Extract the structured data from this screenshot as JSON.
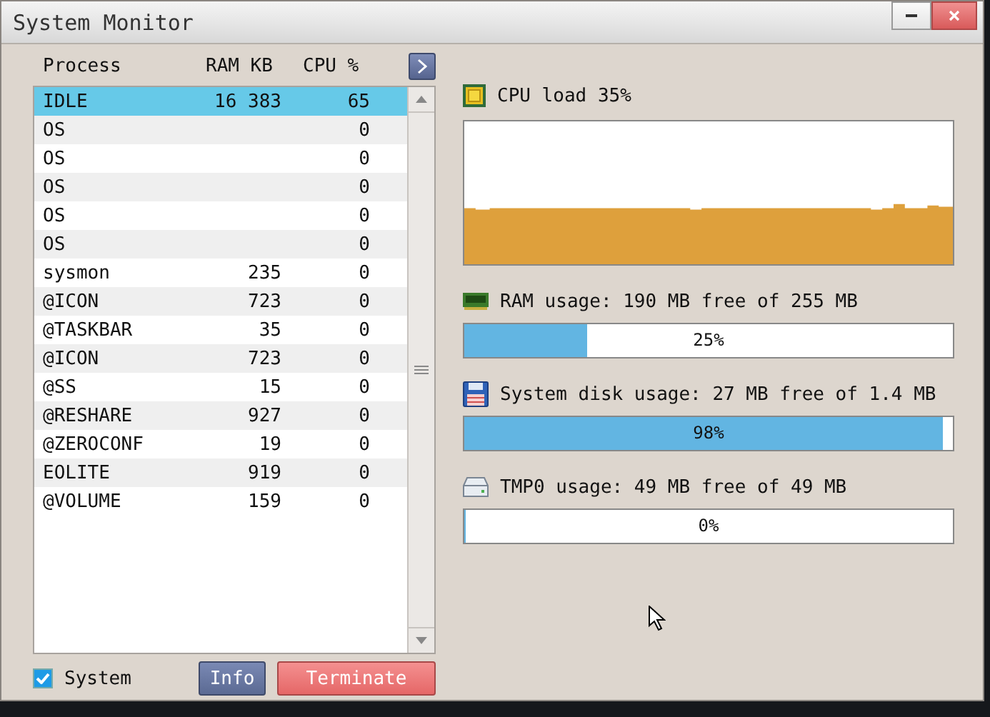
{
  "window": {
    "title": "System Monitor"
  },
  "process_table": {
    "columns": [
      "Process",
      "RAM KB",
      "CPU %"
    ],
    "rows": [
      {
        "process": "IDLE",
        "ram_kb": "16 383",
        "cpu": "65",
        "selected": true
      },
      {
        "process": "OS",
        "cpu": "0",
        "selected": false
      },
      {
        "process": "OS",
        "cpu": "0",
        "selected": false
      },
      {
        "process": "OS",
        "cpu": "0",
        "selected": false
      },
      {
        "process": "OS",
        "cpu": "0",
        "selected": false
      },
      {
        "process": "OS",
        "cpu": "0",
        "selected": false
      },
      {
        "process": "sysmon",
        "ram_kb": "235",
        "cpu": "0",
        "selected": false
      },
      {
        "process": "@ICON",
        "ram_kb": "723",
        "cpu": "0",
        "selected": false
      },
      {
        "process": "@TASKBAR",
        "ram_kb": "35",
        "cpu": "0",
        "selected": false
      },
      {
        "process": "@ICON",
        "ram_kb": "723",
        "cpu": "0",
        "selected": false
      },
      {
        "process": "@SS",
        "ram_kb": "15",
        "cpu": "0",
        "selected": false
      },
      {
        "process": "@RESHARE",
        "ram_kb": "927",
        "cpu": "0",
        "selected": false
      },
      {
        "process": "@ZEROCONF",
        "ram_kb": "19",
        "cpu": "0",
        "selected": false
      },
      {
        "process": "EOLITE",
        "ram_kb": "919",
        "cpu": "0",
        "selected": false
      },
      {
        "process": "@VOLUME",
        "ram_kb": "159",
        "cpu": "0",
        "selected": false
      }
    ]
  },
  "system_checkbox": {
    "label": "System",
    "checked": true
  },
  "buttons": [
    {
      "label": "Info",
      "kind": "info"
    },
    {
      "label": "Terminate",
      "kind": "danger"
    }
  ],
  "cpu": {
    "label": "CPU load 35%"
  },
  "meters": [
    {
      "kind": "ram",
      "label": "RAM usage: 190 MB free of 255 MB",
      "level": 0.25,
      "reading": "25%"
    },
    {
      "kind": "disk",
      "label": "System disk usage: 27 MB free of 1.4 MB",
      "level": 0.98,
      "reading": "98%"
    },
    {
      "kind": "drive",
      "label": "TMP0 usage: 49 MB free of 49 MB",
      "level": 0,
      "reading": "0%"
    }
  ]
}
